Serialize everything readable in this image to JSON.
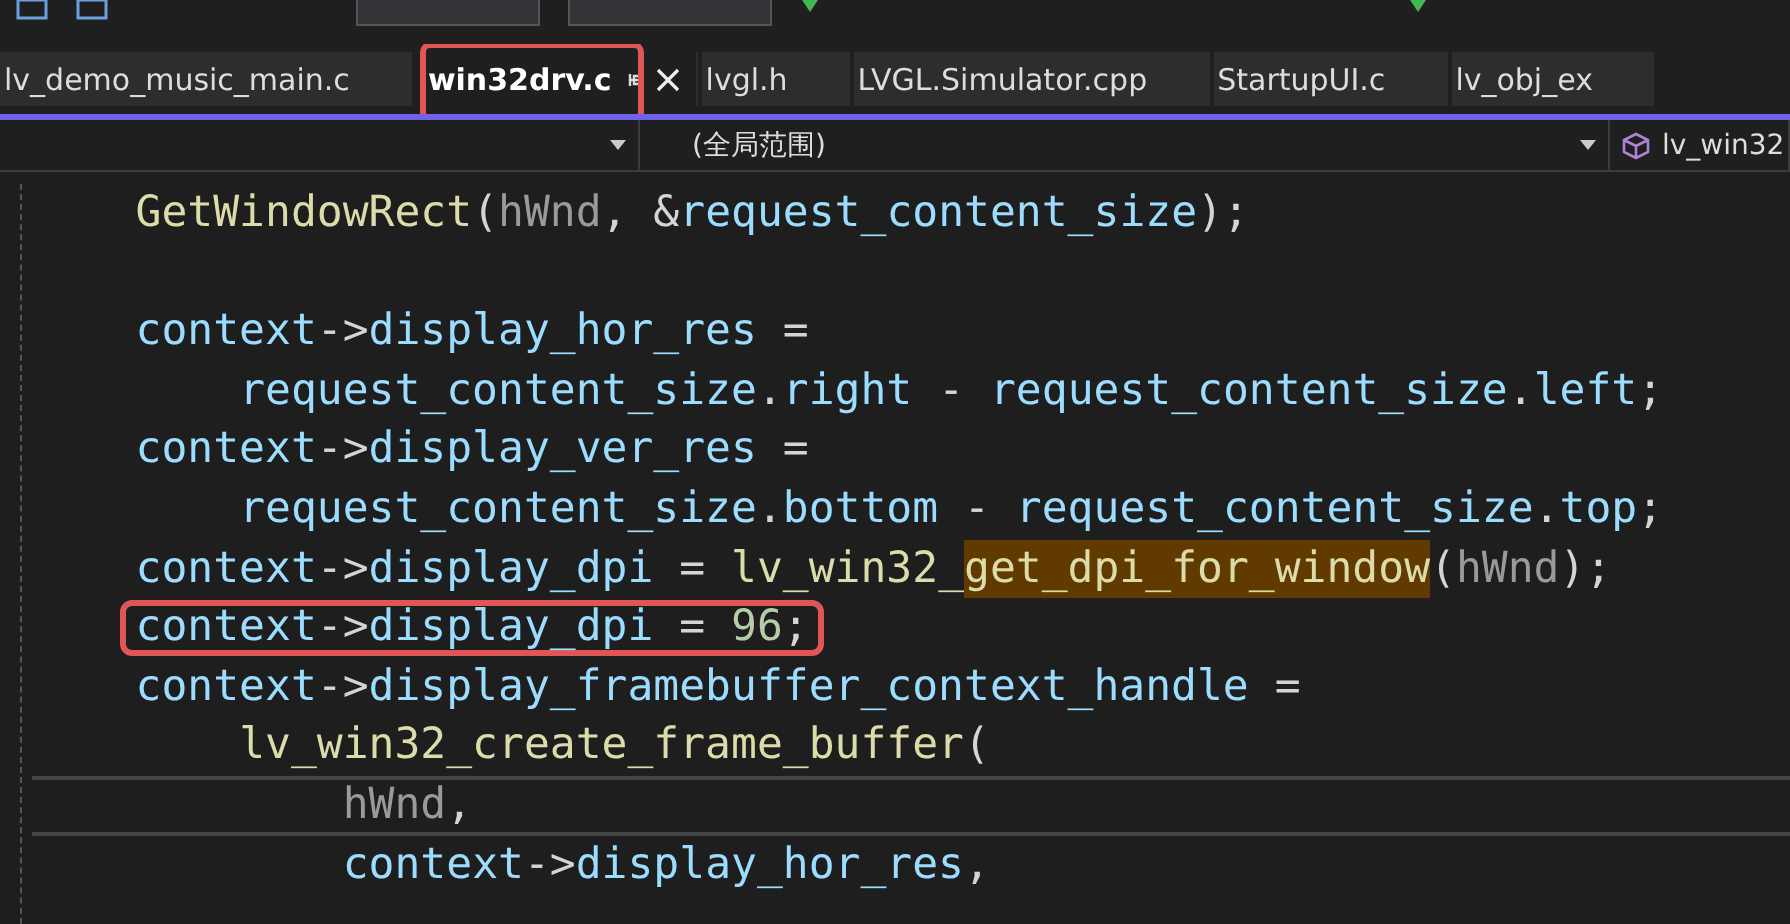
{
  "tabs": [
    {
      "label": "lv_demo_music_main.c",
      "selected": false,
      "annotated": false
    },
    {
      "label": "win32drv.c",
      "selected": true,
      "annotated": true
    },
    {
      "label": "lvgl.h",
      "selected": false,
      "annotated": false
    },
    {
      "label": "LVGL.Simulator.cpp",
      "selected": false,
      "annotated": false
    },
    {
      "label": "StartupUI.c",
      "selected": false,
      "annotated": false
    },
    {
      "label": "lv_obj_ex",
      "selected": false,
      "annotated": false
    }
  ],
  "nav_bar": {
    "scope": "(全局范围)",
    "member": "lv_win32"
  },
  "code_lines": [
    {
      "current": false,
      "annotated": false,
      "tokens": [
        {
          "kind": "func",
          "text": "    GetWindowRect"
        },
        {
          "kind": "plain",
          "text": "("
        },
        {
          "kind": "param",
          "text": "hWnd"
        },
        {
          "kind": "plain",
          "text": ", &"
        },
        {
          "kind": "var",
          "text": "request_content_size"
        },
        {
          "kind": "plain",
          "text": ");"
        }
      ]
    },
    {
      "current": false,
      "annotated": false
    },
    {
      "current": false,
      "annotated": false,
      "tokens": [
        {
          "kind": "var",
          "text": "    context"
        },
        {
          "kind": "plain",
          "text": "->"
        },
        {
          "kind": "var",
          "text": "display_hor_res"
        },
        {
          "kind": "plain",
          "text": " ="
        }
      ]
    },
    {
      "current": false,
      "annotated": false,
      "tokens": [
        {
          "kind": "var",
          "text": "        request_content_size"
        },
        {
          "kind": "plain",
          "text": "."
        },
        {
          "kind": "var",
          "text": "right"
        },
        {
          "kind": "plain",
          "text": " - "
        },
        {
          "kind": "var",
          "text": "request_content_size"
        },
        {
          "kind": "plain",
          "text": "."
        },
        {
          "kind": "var",
          "text": "left"
        },
        {
          "kind": "plain",
          "text": ";"
        }
      ]
    },
    {
      "current": false,
      "annotated": false,
      "tokens": [
        {
          "kind": "var",
          "text": "    context"
        },
        {
          "kind": "plain",
          "text": "->"
        },
        {
          "kind": "var",
          "text": "display_ver_res"
        },
        {
          "kind": "plain",
          "text": " ="
        }
      ]
    },
    {
      "current": false,
      "annotated": false,
      "tokens": [
        {
          "kind": "var",
          "text": "        request_content_size"
        },
        {
          "kind": "plain",
          "text": "."
        },
        {
          "kind": "var",
          "text": "bottom"
        },
        {
          "kind": "plain",
          "text": " - "
        },
        {
          "kind": "var",
          "text": "request_content_size"
        },
        {
          "kind": "plain",
          "text": "."
        },
        {
          "kind": "var",
          "text": "top"
        },
        {
          "kind": "plain",
          "text": ";"
        }
      ]
    },
    {
      "current": false,
      "annotated": false,
      "tokens": [
        {
          "kind": "var",
          "text": "    context"
        },
        {
          "kind": "plain",
          "text": "->"
        },
        {
          "kind": "var",
          "text": "display_dpi"
        },
        {
          "kind": "plain",
          "text": " = "
        },
        {
          "kind": "func",
          "text": "lv_win32_"
        },
        {
          "kind": "match",
          "text": "get_dpi_for_window"
        },
        {
          "kind": "plain",
          "text": "("
        },
        {
          "kind": "param",
          "text": "hWnd"
        },
        {
          "kind": "plain",
          "text": ");"
        }
      ]
    },
    {
      "current": false,
      "annotated": true,
      "tokens": [
        {
          "kind": "var",
          "text": "context"
        },
        {
          "kind": "plain",
          "text": "->"
        },
        {
          "kind": "var",
          "text": "display_dpi"
        },
        {
          "kind": "plain",
          "text": " = "
        },
        {
          "kind": "num",
          "text": "96"
        },
        {
          "kind": "plain",
          "text": ";"
        }
      ]
    },
    {
      "current": false,
      "annotated": false,
      "tokens": [
        {
          "kind": "var",
          "text": "    context"
        },
        {
          "kind": "plain",
          "text": "->"
        },
        {
          "kind": "var",
          "text": "display_framebuffer_context_handle"
        },
        {
          "kind": "plain",
          "text": " ="
        }
      ]
    },
    {
      "current": false,
      "annotated": false,
      "tokens": [
        {
          "kind": "func",
          "text": "        lv_win32_create_frame_buffer"
        },
        {
          "kind": "plain",
          "text": "("
        }
      ]
    },
    {
      "current": true,
      "annotated": false,
      "tokens": [
        {
          "kind": "param",
          "text": "            hWnd"
        },
        {
          "kind": "plain",
          "text": ","
        }
      ]
    },
    {
      "current": false,
      "annotated": false,
      "tokens": [
        {
          "kind": "var",
          "text": "            context"
        },
        {
          "kind": "plain",
          "text": "->"
        },
        {
          "kind": "var",
          "text": "display_hor_res"
        },
        {
          "kind": "plain",
          "text": ","
        }
      ]
    }
  ]
}
